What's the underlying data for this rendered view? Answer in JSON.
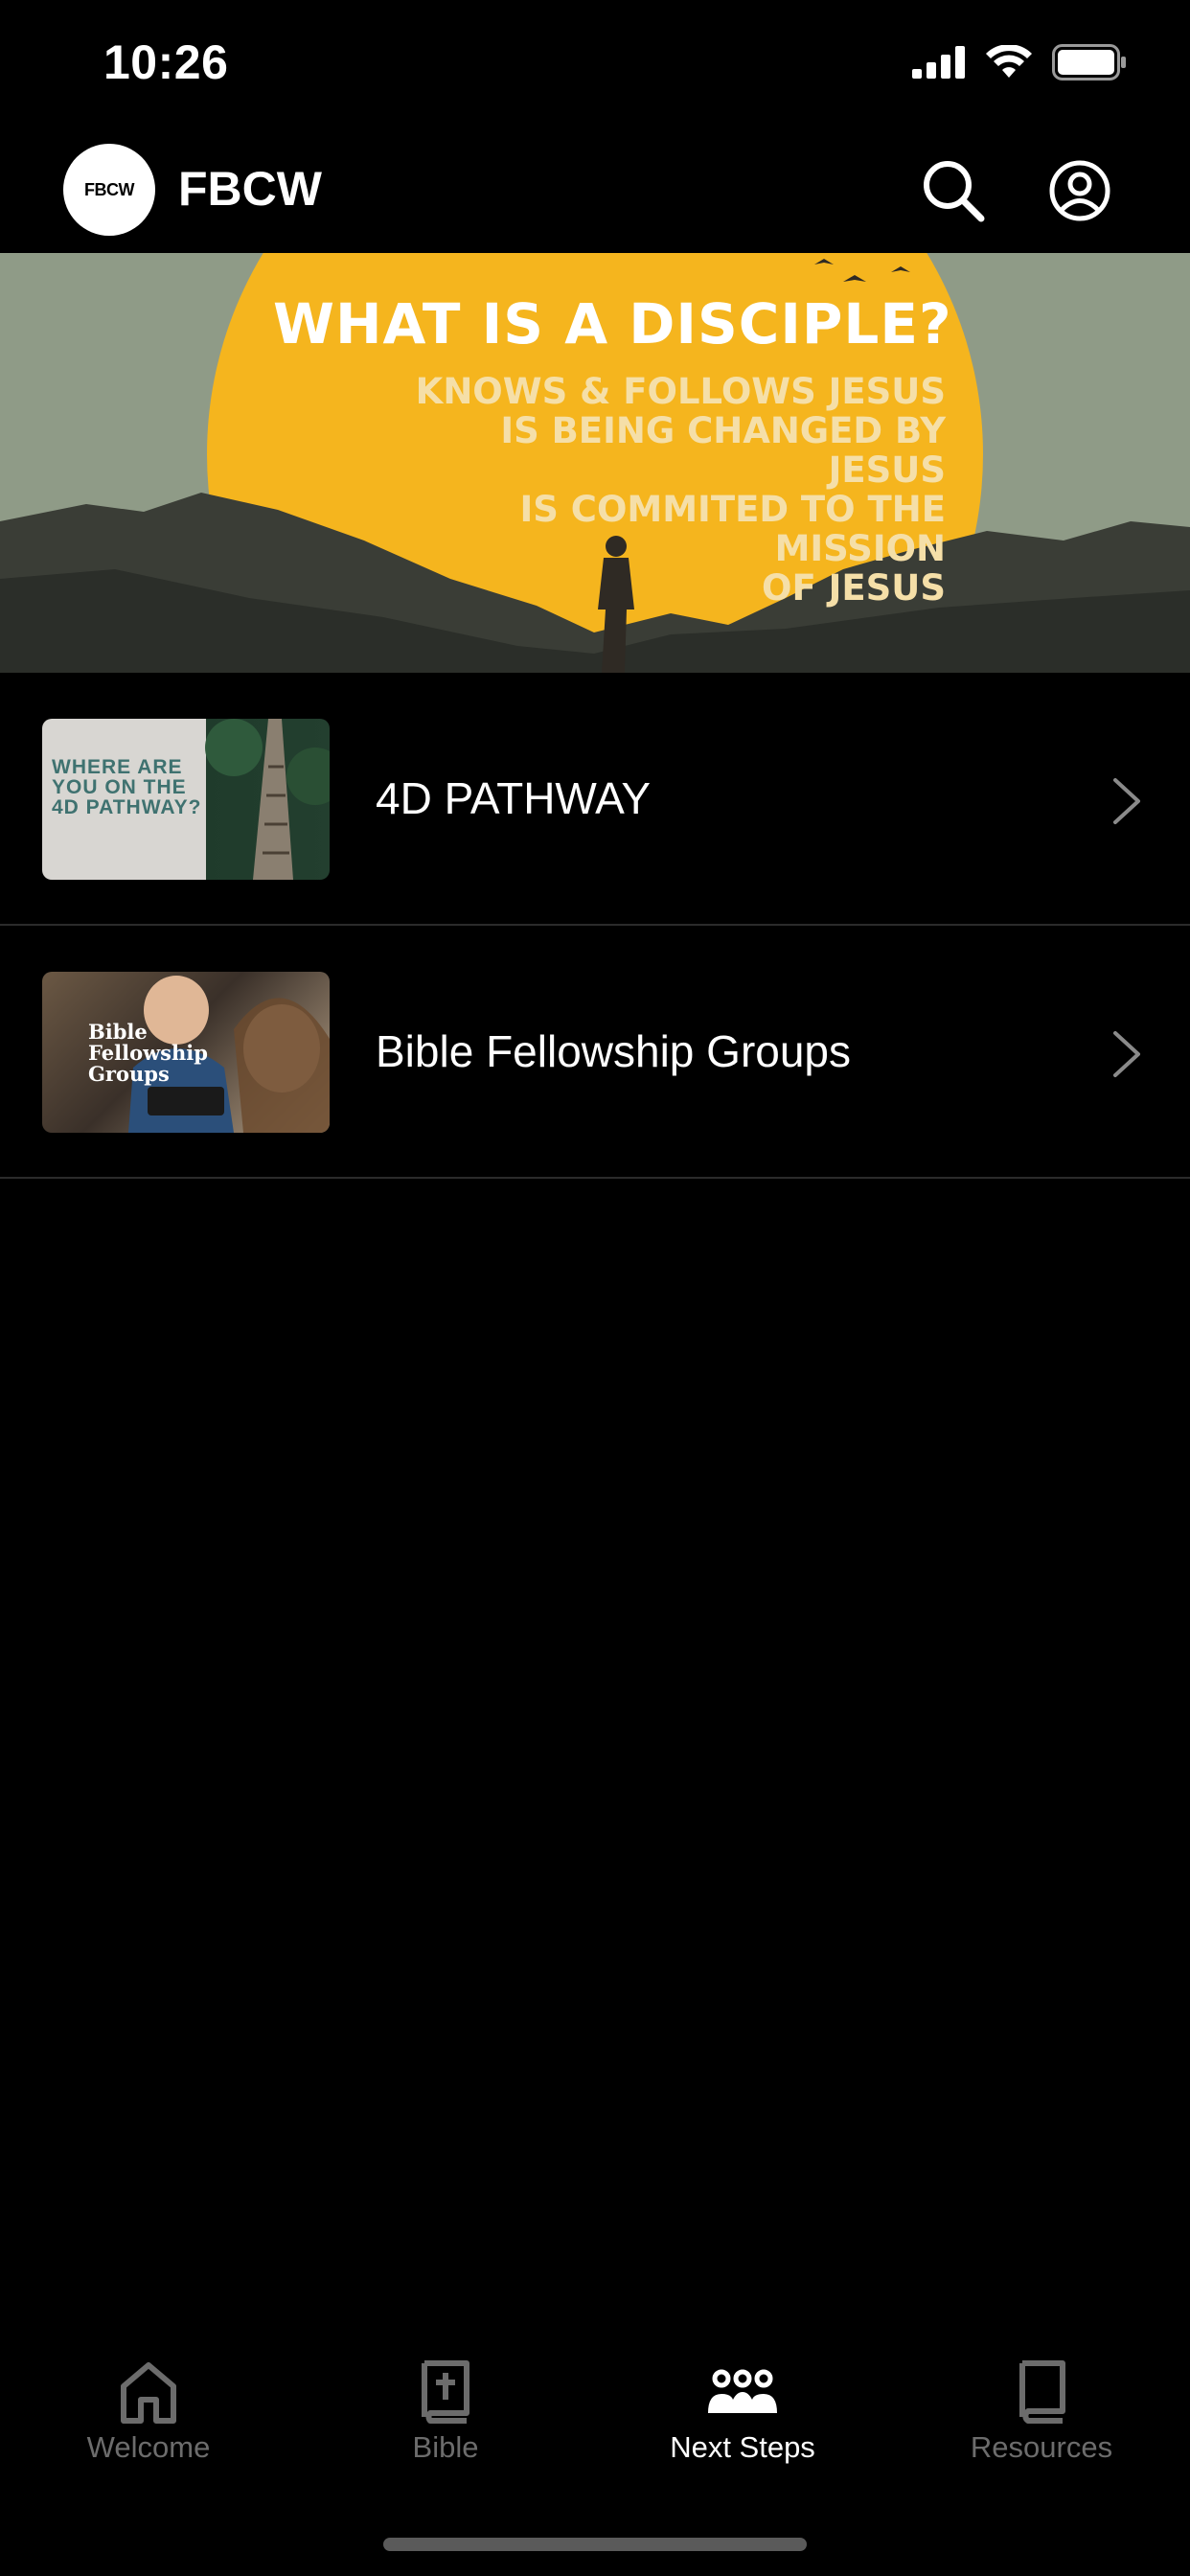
{
  "status_bar": {
    "time": "10:26"
  },
  "header": {
    "logo_text": "FBCW",
    "title": "FBCW"
  },
  "hero": {
    "title": "WHAT IS A DISCIPLE?",
    "lines": [
      "KNOWS & FOLLOWS JESUS",
      "IS BEING CHANGED BY",
      "JESUS",
      "IS COMMITED TO THE",
      "MISSION",
      "OF JESUS"
    ],
    "colors": {
      "sun": "#f5b51e",
      "sky": "#8f9b87",
      "hills": "#3a3d36"
    }
  },
  "list": {
    "items": [
      {
        "label": "4D PATHWAY",
        "thumb_text": "WHERE ARE YOU ON THE 4D PATHWAY?"
      },
      {
        "label": "Bible Fellowship Groups",
        "thumb_text": "Bible Fellowship Groups"
      }
    ]
  },
  "tabs": [
    {
      "label": "Welcome",
      "icon": "home-icon",
      "active": false
    },
    {
      "label": "Bible",
      "icon": "bible-icon",
      "active": false
    },
    {
      "label": "Next Steps",
      "icon": "people-icon",
      "active": true
    },
    {
      "label": "Resources",
      "icon": "book-icon",
      "active": false
    }
  ]
}
